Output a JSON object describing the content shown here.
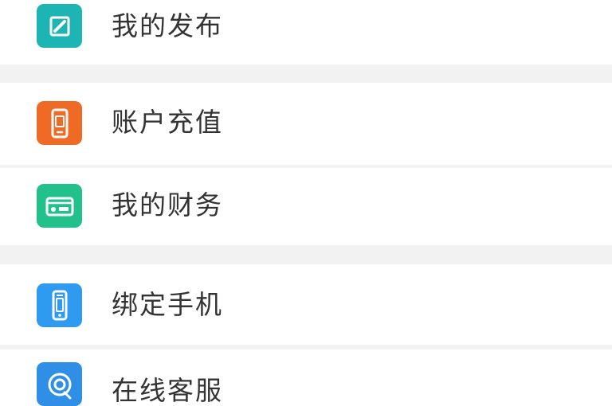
{
  "menu": {
    "items": [
      {
        "label": "我的发布",
        "icon": "edit-icon",
        "color": "#1db4b4"
      },
      {
        "label": "账户充值",
        "icon": "phone-recharge-icon",
        "color": "#ef6a24"
      },
      {
        "label": "我的财务",
        "icon": "wallet-icon",
        "color": "#22c08a"
      },
      {
        "label": "绑定手机",
        "icon": "mobile-phone-icon",
        "color": "#2e9bf0"
      },
      {
        "label": "在线客服",
        "icon": "customer-service-icon",
        "color": "#2f8fe6"
      }
    ]
  }
}
